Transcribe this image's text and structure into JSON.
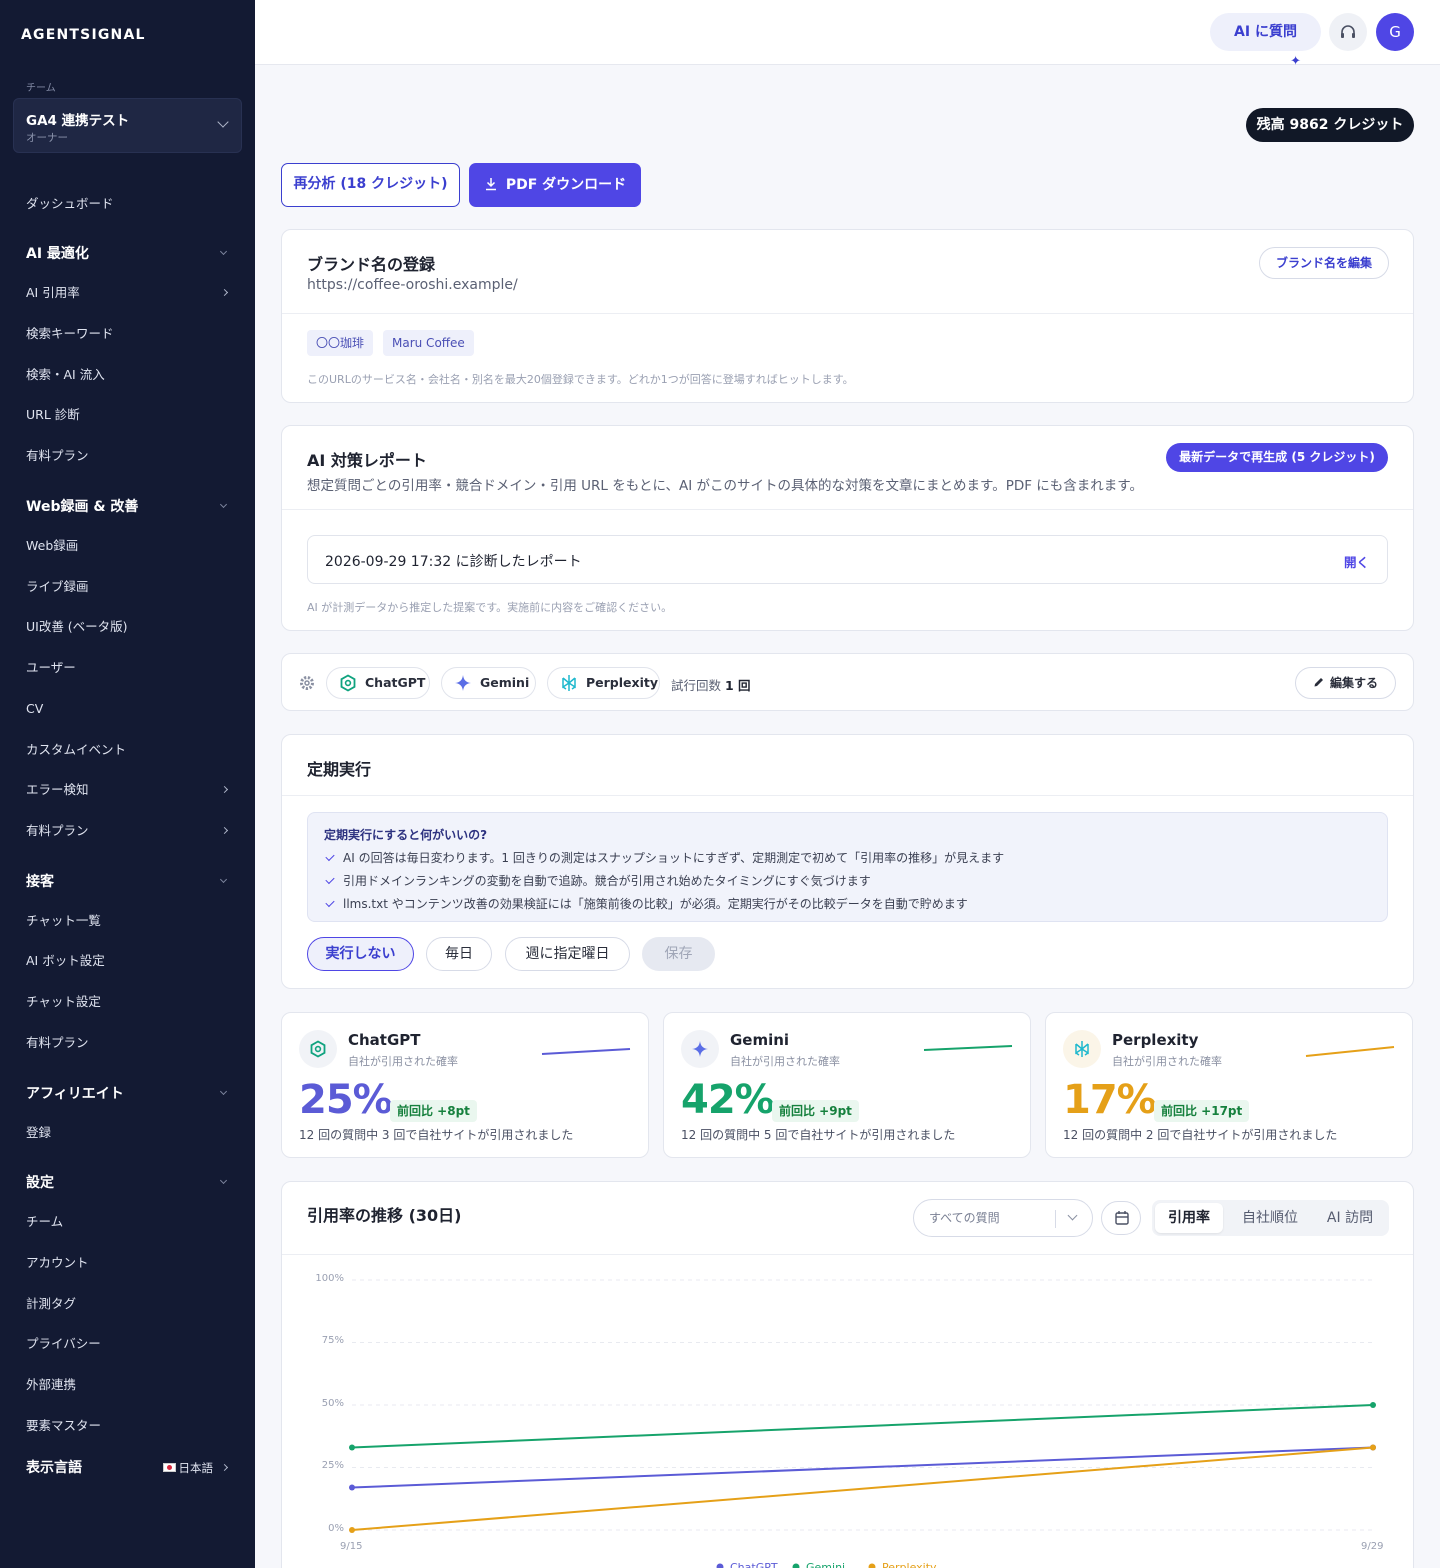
{
  "sidebar": {
    "brand": "AGENTSIGNAL",
    "team_caption": "チーム",
    "team_name": "GA4 連携テスト",
    "team_role": "オーナー",
    "dashboard": "ダッシュボード",
    "sections": {
      "ai": "AI 最適化",
      "web": "Web録画 & 改善",
      "support": "接客",
      "affiliate": "アフィリエイト",
      "settings": "設定",
      "language": "表示言語"
    },
    "ai_items": [
      "AI 引用率",
      "検索キーワード",
      "検索・AI 流入",
      "URL 診断",
      "有料プラン"
    ],
    "web_items": [
      "Web録画",
      "ライブ録画",
      "UI改善 (ベータ版)",
      "ユーザー",
      "CV",
      "カスタムイベント",
      "エラー検知",
      "有料プラン"
    ],
    "support_items": [
      "チャット一覧",
      "AI ボット設定",
      "チャット設定",
      "有料プラン"
    ],
    "affiliate_items": [
      "登録"
    ],
    "settings_items": [
      "チーム",
      "アカウント",
      "計測タグ",
      "プライバシー",
      "外部連携",
      "要素マスター"
    ],
    "language_value": "日本語"
  },
  "topbar": {
    "ai_button": "AI に質問",
    "avatar_initial": "G",
    "spark_glyph": "✦"
  },
  "credits": "残高 9862 クレジット",
  "actions": {
    "reanalyze": "再分析 (18 クレジット)",
    "pdf": "PDF ダウンロード"
  },
  "brand_card": {
    "title": "ブランド名の登録",
    "url": "https://coffee-oroshi.example/",
    "edit_button": "ブランド名を編集",
    "tags": [
      "〇〇珈琲",
      "Maru Coffee"
    ],
    "note": "このURLのサービス名・会社名・別名を最大20個登録できます。どれか1つが回答に登場すればヒットします。"
  },
  "report_card": {
    "title": "AI 対策レポート",
    "description": "想定質問ごとの引用率・競合ドメイン・引用 URL をもとに、AI がこのサイトの具体的な対策を文章にまとめます。PDF にも含まれます。",
    "regen_button": "最新データで再生成 (5 クレジット)",
    "report_label": "2026-09-29 17:32 に診断したレポート",
    "open": "開く",
    "footnote": "AI が計測データから推定した提案です。実施前に内容をご確認ください。"
  },
  "engines_bar": {
    "engines": [
      "ChatGPT",
      "Gemini",
      "Perplexity"
    ],
    "trials_label": "試行回数",
    "trials_value": "1 回",
    "edit": "編集する"
  },
  "schedule": {
    "title": "定期実行",
    "info_title": "定期実行にすると何がいいの?",
    "benefits": [
      "AI の回答は毎日変わります。1 回きりの測定はスナップショットにすぎず、定期測定で初めて「引用率の推移」が見えます",
      "引用ドメインランキングの変動を自動で追跡。競合が引用され始めたタイミングにすぐ気づけます",
      "llms.txt やコンテンツ改善の効果検証には「施策前後の比較」が必須。定期実行がその比較データを自動で貯めます"
    ],
    "options": [
      "実行しない",
      "毎日",
      "週に指定曜日"
    ],
    "selected_option": "実行しない",
    "save": "保存"
  },
  "stats": [
    {
      "name": "ChatGPT",
      "sub": "自社が引用された確率",
      "pct": "25%",
      "delta": "前回比 +8pt",
      "desc": "12 回の質問中 3 回で自社サイトが引用されました",
      "color": "#5b5bd6"
    },
    {
      "name": "Gemini",
      "sub": "自社が引用された確率",
      "pct": "42%",
      "delta": "前回比 +9pt",
      "desc": "12 回の質問中 5 回で自社サイトが引用されました",
      "color": "#16a36b"
    },
    {
      "name": "Perplexity",
      "sub": "自社が引用された確率",
      "pct": "17%",
      "delta": "前回比 +17pt",
      "desc": "12 回の質問中 2 回で自社サイトが引用されました",
      "color": "#e5a018"
    }
  ],
  "trend": {
    "title": "引用率の推移 (30日)",
    "filter": "すべての質問",
    "tabs": [
      "引用率",
      "自社順位",
      "AI 訪問"
    ],
    "active_tab": "引用率"
  },
  "chart_data": {
    "type": "line",
    "x": [
      "9/15",
      "9/29"
    ],
    "yticks": [
      "100%",
      "75%",
      "50%",
      "25%",
      "0%"
    ],
    "ylim": [
      0,
      100
    ],
    "grid": true,
    "series": [
      {
        "name": "ChatGPT",
        "values": [
          17,
          33
        ],
        "color": "#5b5bd6"
      },
      {
        "name": "Gemini",
        "values": [
          33,
          50
        ],
        "color": "#16a36b"
      },
      {
        "name": "Perplexity",
        "values": [
          0,
          33
        ],
        "color": "#e5a018"
      }
    ]
  }
}
